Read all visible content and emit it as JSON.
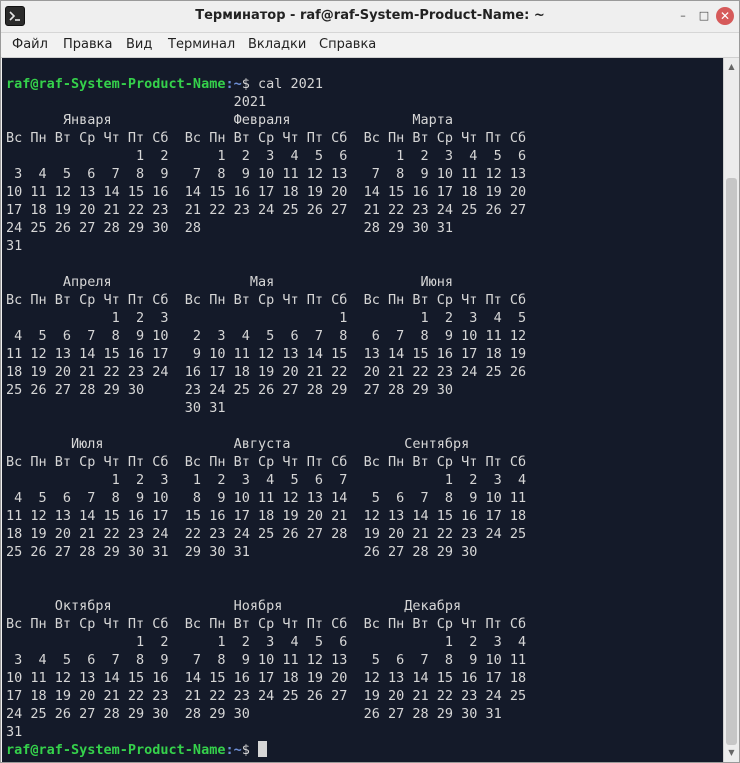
{
  "window": {
    "title": "Терминатор - raf@raf-System-Product-Name: ~",
    "icon": "terminal-icon",
    "controls": {
      "minimize": "–",
      "maximize": "□",
      "close": "✕"
    }
  },
  "menu": {
    "file": "Файл",
    "edit": "Правка",
    "view": "Вид",
    "terminal": "Терминал",
    "tabs": "Вкладки",
    "help": "Справка"
  },
  "terminal": {
    "prompt_user": "raf@raf-System-Product-Name",
    "prompt_path": ":~",
    "prompt_symbol": "$ ",
    "command": "cal 2021",
    "output": "                            2021\n       Января               Февраля               Марта\nВс Пн Вт Ср Чт Пт Сб  Вс Пн Вт Ср Чт Пт Сб  Вс Пн Вт Ср Чт Пт Сб\n                1  2      1  2  3  4  5  6      1  2  3  4  5  6\n 3  4  5  6  7  8  9   7  8  9 10 11 12 13   7  8  9 10 11 12 13\n10 11 12 13 14 15 16  14 15 16 17 18 19 20  14 15 16 17 18 19 20\n17 18 19 20 21 22 23  21 22 23 24 25 26 27  21 22 23 24 25 26 27\n24 25 26 27 28 29 30  28                    28 29 30 31\n31\n\n       Апреля                 Мая                  Июня\nВс Пн Вт Ср Чт Пт Сб  Вс Пн Вт Ср Чт Пт Сб  Вс Пн Вт Ср Чт Пт Сб\n             1  2  3                     1         1  2  3  4  5\n 4  5  6  7  8  9 10   2  3  4  5  6  7  8   6  7  8  9 10 11 12\n11 12 13 14 15 16 17   9 10 11 12 13 14 15  13 14 15 16 17 18 19\n18 19 20 21 22 23 24  16 17 18 19 20 21 22  20 21 22 23 24 25 26\n25 26 27 28 29 30     23 24 25 26 27 28 29  27 28 29 30\n                      30 31\n\n        Июля                Августа              Сентября\nВс Пн Вт Ср Чт Пт Сб  Вс Пн Вт Ср Чт Пт Сб  Вс Пн Вт Ср Чт Пт Сб\n             1  2  3   1  2  3  4  5  6  7            1  2  3  4\n 4  5  6  7  8  9 10   8  9 10 11 12 13 14   5  6  7  8  9 10 11\n11 12 13 14 15 16 17  15 16 17 18 19 20 21  12 13 14 15 16 17 18\n18 19 20 21 22 23 24  22 23 24 25 26 27 28  19 20 21 22 23 24 25\n25 26 27 28 29 30 31  29 30 31              26 27 28 29 30\n\n\n      Октября               Ноября               Декабря\nВс Пн Вт Ср Чт Пт Сб  Вс Пн Вт Ср Чт Пт Сб  Вс Пн Вт Ср Чт Пт Сб\n                1  2      1  2  3  4  5  6            1  2  3  4\n 3  4  5  6  7  8  9   7  8  9 10 11 12 13   5  6  7  8  9 10 11\n10 11 12 13 14 15 16  14 15 16 17 18 19 20  12 13 14 15 16 17 18\n17 18 19 20 21 22 23  21 22 23 24 25 26 27  19 20 21 22 23 24 25\n24 25 26 27 28 29 30  28 29 30              26 27 28 29 30 31\n31",
    "colors": {
      "background": "#141a29",
      "text": "#d6d6d6",
      "prompt_user": "#35d14b",
      "prompt_path": "#6d8fd6"
    }
  }
}
